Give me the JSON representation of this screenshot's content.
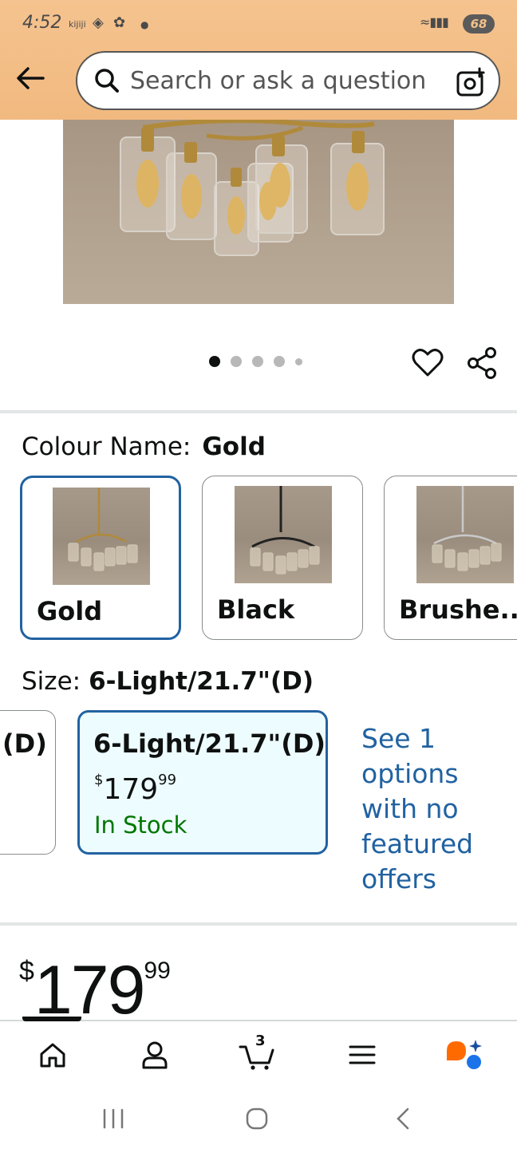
{
  "status_bar": {
    "time": "4:52",
    "app_badge": "kijiji",
    "battery": "68"
  },
  "search": {
    "placeholder": "Search or ask a question"
  },
  "carousel": {
    "total_images": 5,
    "active_index": 0
  },
  "colour": {
    "label": "Colour Name:",
    "selected": "Gold",
    "options": [
      {
        "name": "Gold",
        "selected": true
      },
      {
        "name": "Black",
        "selected": false
      },
      {
        "name": "Brushe...",
        "selected": false
      }
    ]
  },
  "size": {
    "label": "Size:",
    "selected": "6-Light/21.7\"(D)",
    "partial_option": "(D)",
    "selected_option": {
      "name": "6-Light/21.7\"(D)",
      "price_currency": "$",
      "price_whole": "179",
      "price_fraction": "99",
      "stock": "In Stock"
    },
    "see_options": "See 1 options with no featured offers"
  },
  "price": {
    "currency": "$",
    "whole": "179",
    "fraction": "99"
  },
  "bottom_nav": {
    "items": [
      "home-icon",
      "account-icon",
      "cart-icon",
      "menu-icon",
      "rufus-icon"
    ],
    "cart_count": "3",
    "active": "home"
  },
  "colors": {
    "header": "#f1b97f",
    "accent_blue": "#2162a1",
    "in_stock_green": "#007600",
    "selected_bg": "#edfdff"
  }
}
